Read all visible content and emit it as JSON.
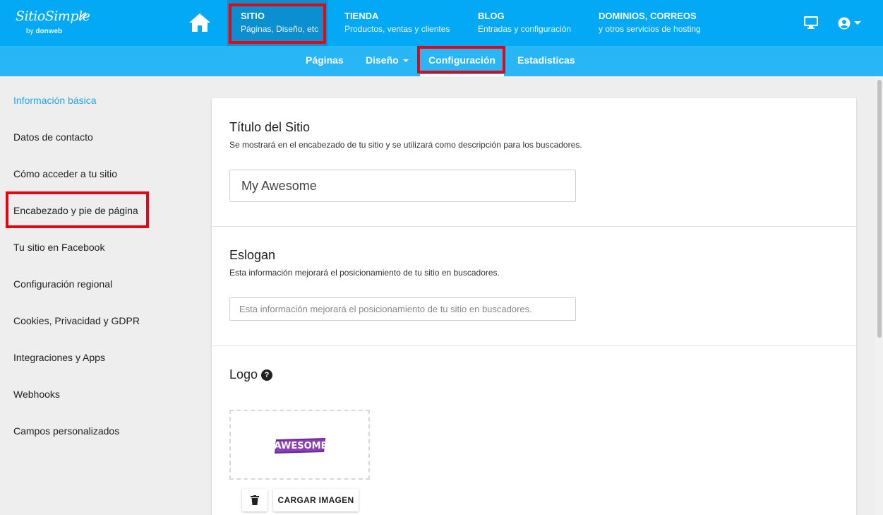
{
  "brand": {
    "name": "SitioSimple",
    "by_prefix": "by",
    "by_name": "donweb",
    "icon": "logo-swoosh"
  },
  "header": {
    "home_icon": "home-icon",
    "nav": [
      {
        "title": "SITIO",
        "subtitle": "Páginas, Diseño, etc"
      },
      {
        "title": "TIENDA",
        "subtitle": "Productos, ventas y clientes"
      },
      {
        "title": "BLOG",
        "subtitle": "Entradas y configuración"
      },
      {
        "title": "DOMINIOS, CORREOS",
        "subtitle": "y otros servicios de hosting"
      }
    ],
    "right_icons": [
      "monitor-icon",
      "account-icon",
      "chevron-down-icon"
    ]
  },
  "subnav": {
    "items": [
      "Páginas",
      "Diseño",
      "Configuración",
      "Estadisticas"
    ],
    "active": "Configuración"
  },
  "sidebar": {
    "items": [
      "Información básica",
      "Datos de contacto",
      "Cómo acceder a tu sitio",
      "Encabezado y pie de página",
      "Tu sitio en Facebook",
      "Configuración regional",
      "Cookies, Privacidad y GDPR",
      "Integraciones y Apps",
      "Webhooks",
      "Campos personalizados"
    ],
    "active": "Información básica"
  },
  "main": {
    "site_title": {
      "heading": "Título del Sitio",
      "description": "Se mostrará en el encabezado de tu sitio y se utilizará como descripción para los buscadores.",
      "value": "My Awesome"
    },
    "eslogan": {
      "heading": "Eslogan",
      "description": "Esta información mejorará el posicionamiento de tu sitio en buscadores.",
      "placeholder": "Esta información mejorará el posicionamiento de tu sitio en buscadores.",
      "value": ""
    },
    "logo": {
      "heading": "Logo",
      "help_icon": "question-circle-icon",
      "image_text": "AWESOME",
      "delete_icon": "trash-icon",
      "upload_label": "CARGAR IMAGEN"
    }
  },
  "colors": {
    "header_bg": "#03a9f4",
    "subnav_bg": "#29b6f6",
    "active_nav_bg": "#0a8fd0",
    "sidebar_active": "#29a3e0",
    "annotation_red": "#e30613",
    "logo_purple": "#6a2c91"
  }
}
